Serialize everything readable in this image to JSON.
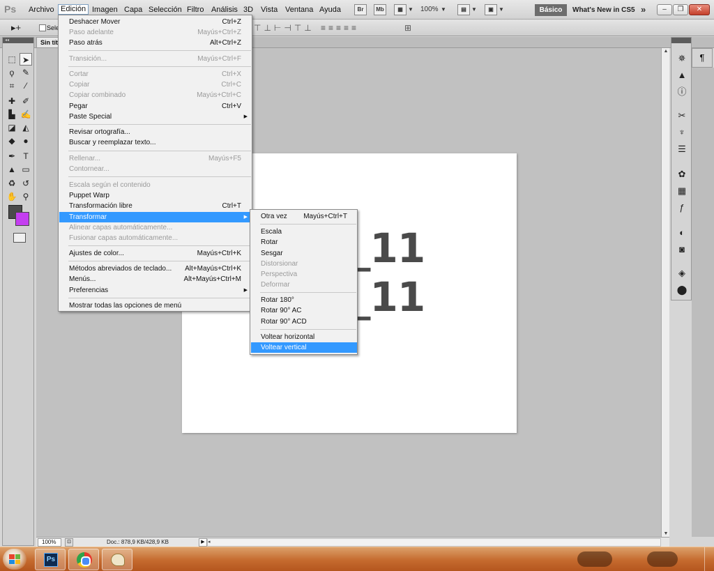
{
  "app": {
    "logo": "Ps"
  },
  "menubar": {
    "items": [
      "Archivo",
      "Edición",
      "Imagen",
      "Capa",
      "Selección",
      "Filtro",
      "Análisis",
      "3D",
      "Vista",
      "Ventana",
      "Ayuda"
    ],
    "bridge_icon": "Br",
    "minibridge_icon": "Mb",
    "zoom": "100%",
    "workspace": "Básico",
    "whats_new": "What's New in CS5",
    "more": "»"
  },
  "window_controls": {
    "minimize": "‒",
    "restore": "❐",
    "close": "✕"
  },
  "options": {
    "move_tool": "▸+",
    "auto_select_label": "Selec"
  },
  "document": {
    "tab_title": "Sin títu",
    "text_line1": "Pakitu_11",
    "text_line2": "Pakitu_11"
  },
  "tools": {
    "foreground_color": "#4b4b4b",
    "background_color": "#c43ef0"
  },
  "edit_menu": {
    "items": [
      {
        "label": "Deshacer Mover",
        "shortcut": "Ctrl+Z",
        "disabled": false
      },
      {
        "label": "Paso adelante",
        "shortcut": "Mayús+Ctrl+Z",
        "disabled": true
      },
      {
        "label": "Paso atrás",
        "shortcut": "Alt+Ctrl+Z",
        "disabled": false
      },
      {
        "label": "Transición...",
        "shortcut": "Mayús+Ctrl+F",
        "disabled": true
      },
      {
        "label": "Cortar",
        "shortcut": "Ctrl+X",
        "disabled": true
      },
      {
        "label": "Copiar",
        "shortcut": "Ctrl+C",
        "disabled": true
      },
      {
        "label": "Copiar combinado",
        "shortcut": "Mayús+Ctrl+C",
        "disabled": true
      },
      {
        "label": "Pegar",
        "shortcut": "Ctrl+V",
        "disabled": false
      },
      {
        "label": "Paste Special",
        "shortcut": "",
        "disabled": false,
        "submenu": true
      },
      {
        "label": "Revisar ortografía...",
        "shortcut": "",
        "disabled": false
      },
      {
        "label": "Buscar y reemplazar texto...",
        "shortcut": "",
        "disabled": false
      },
      {
        "label": "Rellenar...",
        "shortcut": "Mayús+F5",
        "disabled": true
      },
      {
        "label": "Contornear...",
        "shortcut": "",
        "disabled": true
      },
      {
        "label": "Escala según el contenido",
        "shortcut": "",
        "disabled": true
      },
      {
        "label": "Puppet Warp",
        "shortcut": "",
        "disabled": false
      },
      {
        "label": "Transformación libre",
        "shortcut": "Ctrl+T",
        "disabled": false
      },
      {
        "label": "Transformar",
        "shortcut": "",
        "disabled": false,
        "submenu": true,
        "highlighted": true
      },
      {
        "label": "Alinear capas automáticamente...",
        "shortcut": "",
        "disabled": true
      },
      {
        "label": "Fusionar capas automáticamente...",
        "shortcut": "",
        "disabled": true
      },
      {
        "label": "Ajustes de color...",
        "shortcut": "Mayús+Ctrl+K",
        "disabled": false
      },
      {
        "label": "Métodos abreviados de teclado...",
        "shortcut": "Alt+Mayús+Ctrl+K",
        "disabled": false
      },
      {
        "label": "Menús...",
        "shortcut": "Alt+Mayús+Ctrl+M",
        "disabled": false
      },
      {
        "label": "Preferencias",
        "shortcut": "",
        "disabled": false,
        "submenu": true
      },
      {
        "label": "Mostrar todas las opciones de menú",
        "shortcut": "",
        "disabled": false
      }
    ]
  },
  "transform_submenu": {
    "items": [
      {
        "label": "Otra vez",
        "shortcut": "Mayús+Ctrl+T",
        "disabled": false
      },
      {
        "label": "Escala",
        "shortcut": "",
        "disabled": false
      },
      {
        "label": "Rotar",
        "shortcut": "",
        "disabled": false
      },
      {
        "label": "Sesgar",
        "shortcut": "",
        "disabled": false
      },
      {
        "label": "Distorsionar",
        "shortcut": "",
        "disabled": true
      },
      {
        "label": "Perspectiva",
        "shortcut": "",
        "disabled": true
      },
      {
        "label": "Deformar",
        "shortcut": "",
        "disabled": true
      },
      {
        "label": "Rotar 180°",
        "shortcut": "",
        "disabled": false
      },
      {
        "label": "Rotar 90° AC",
        "shortcut": "",
        "disabled": false
      },
      {
        "label": "Rotar 90° ACD",
        "shortcut": "",
        "disabled": false
      },
      {
        "label": "Voltear horizontal",
        "shortcut": "",
        "disabled": false
      },
      {
        "label": "Voltear vertical",
        "shortcut": "",
        "disabled": false,
        "highlighted": true
      }
    ]
  },
  "status": {
    "zoom": "100%",
    "doc_info": "Doc.: 878,9 KB/428,9 KB"
  },
  "taskbar": {
    "apps": [
      "photoshop",
      "chrome",
      "paint"
    ],
    "ps_label": "Ps"
  }
}
